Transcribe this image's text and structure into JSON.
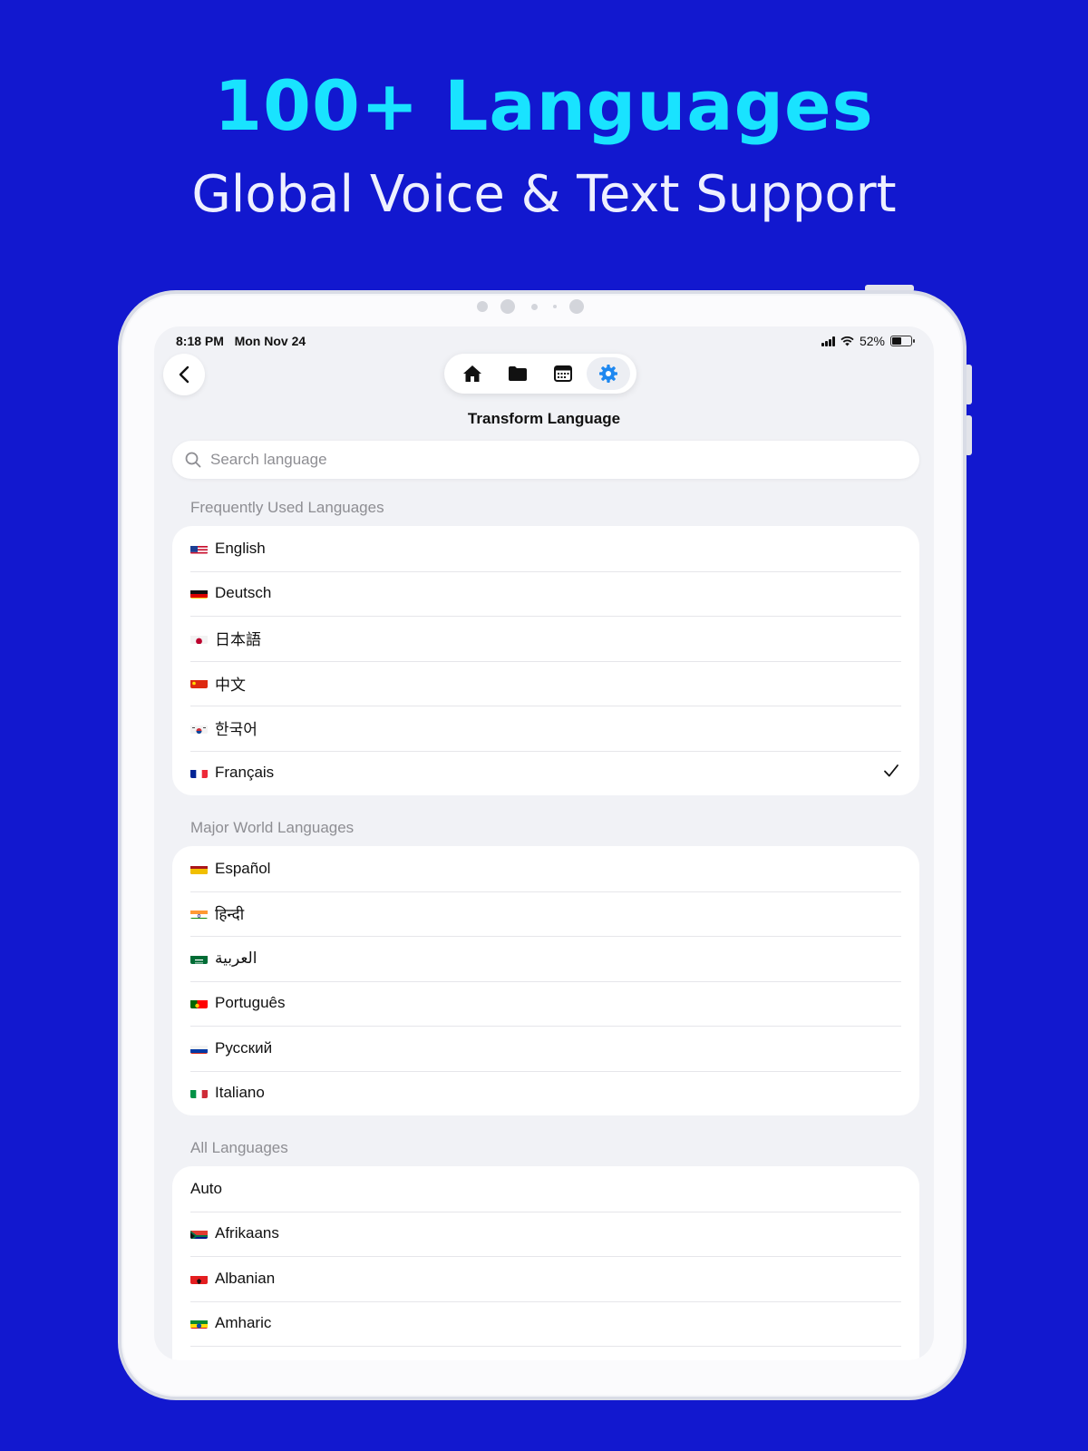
{
  "hero": {
    "headline": "100+ Languages",
    "subline": "Global Voice & Text Support"
  },
  "status_bar": {
    "time": "8:18 PM",
    "date": "Mon Nov 24",
    "battery_percent": "52%",
    "battery_level": 0.52
  },
  "nav": {
    "tabs": [
      {
        "icon": "home-icon",
        "active": false
      },
      {
        "icon": "folder-icon",
        "active": false
      },
      {
        "icon": "calendar-icon",
        "active": false
      },
      {
        "icon": "gear-icon",
        "active": true
      }
    ]
  },
  "page": {
    "title": "Transform Language",
    "search_placeholder": "Search language"
  },
  "sections": [
    {
      "label": "Frequently Used Languages",
      "items": [
        {
          "flag": "us",
          "name": "English",
          "selected": false
        },
        {
          "flag": "de",
          "name": "Deutsch",
          "selected": false
        },
        {
          "flag": "jp",
          "name": "日本語",
          "selected": false
        },
        {
          "flag": "cn",
          "name": "中文",
          "selected": false
        },
        {
          "flag": "kr",
          "name": "한국어",
          "selected": false
        },
        {
          "flag": "fr",
          "name": "Français",
          "selected": true
        }
      ]
    },
    {
      "label": "Major World Languages",
      "items": [
        {
          "flag": "es",
          "name": "Español",
          "selected": false
        },
        {
          "flag": "in",
          "name": "हिन्दी",
          "selected": false
        },
        {
          "flag": "sa",
          "name": "العربية",
          "selected": false
        },
        {
          "flag": "pt",
          "name": "Português",
          "selected": false
        },
        {
          "flag": "ru",
          "name": "Русский",
          "selected": false
        },
        {
          "flag": "it",
          "name": "Italiano",
          "selected": false
        }
      ]
    },
    {
      "label": "All Languages",
      "items": [
        {
          "flag": "",
          "name": "Auto",
          "selected": false
        },
        {
          "flag": "za",
          "name": "Afrikaans",
          "selected": false
        },
        {
          "flag": "al",
          "name": "Albanian",
          "selected": false
        },
        {
          "flag": "et",
          "name": "Amharic",
          "selected": false
        }
      ]
    }
  ],
  "colors": {
    "background": "#1218cf",
    "headline": "#19e3ff",
    "accent": "#1e88f0"
  }
}
